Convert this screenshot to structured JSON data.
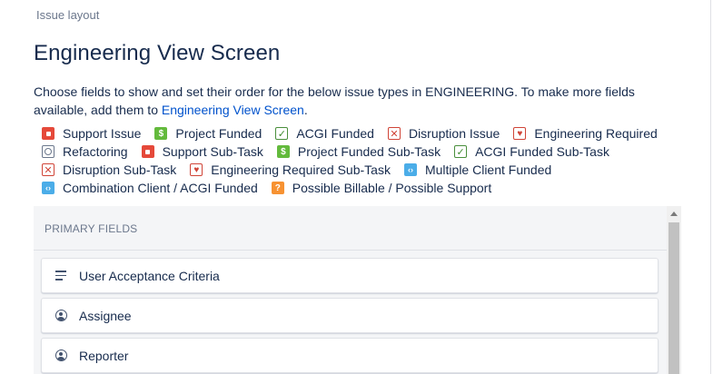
{
  "breadcrumb": "Issue layout",
  "title": "Engineering View Screen",
  "description": {
    "text": "Choose fields to show and set their order for the below issue types in ENGINEERING. To make more fields available, add them to ",
    "link": "Engineering View Screen",
    "suffix": "."
  },
  "issue_types": [
    [
      {
        "label": "Support Issue",
        "icon": "bug-icon",
        "glyph": ""
      },
      {
        "label": "Project Funded",
        "icon": "dollar-icon",
        "glyph": "$"
      },
      {
        "label": "ACGI Funded",
        "icon": "check-icon",
        "glyph": "✓"
      },
      {
        "label": "Disruption Issue",
        "icon": "x-icon",
        "glyph": "✕"
      },
      {
        "label": "Engineering Required",
        "icon": "heart-icon",
        "glyph": "♥"
      }
    ],
    [
      {
        "label": "Refactoring",
        "icon": "refactor-icon",
        "glyph": ""
      },
      {
        "label": "Support Sub-Task",
        "icon": "bug-icon",
        "glyph": ""
      },
      {
        "label": "Project Funded Sub-Task",
        "icon": "dollar-icon",
        "glyph": "$"
      },
      {
        "label": "ACGI Funded Sub-Task",
        "icon": "check-icon",
        "glyph": "✓"
      }
    ],
    [
      {
        "label": "Disruption Sub-Task",
        "icon": "x-icon",
        "glyph": "✕"
      },
      {
        "label": "Engineering Required Sub-Task",
        "icon": "heart-icon",
        "glyph": "♥"
      },
      {
        "label": "Multiple Client Funded",
        "icon": "code-icon",
        "glyph": "‹›"
      }
    ],
    [
      {
        "label": "Combination Client / ACGI Funded",
        "icon": "code-icon",
        "glyph": "‹›"
      },
      {
        "label": "Possible Billable / Possible Support",
        "icon": "question-icon",
        "glyph": "?"
      }
    ]
  ],
  "panel": {
    "header": "PRIMARY FIELDS",
    "fields": [
      {
        "label": "User Acceptance Criteria",
        "icon": "text-lines-icon"
      },
      {
        "label": "Assignee",
        "icon": "user-icon"
      },
      {
        "label": "Reporter",
        "icon": "user-icon"
      }
    ]
  },
  "colors": {
    "link": "#0052cc",
    "bug_red": "#e5493a",
    "funded_green": "#63ba3c",
    "code_blue": "#4bade8",
    "question_orange": "#f79232",
    "panel_bg": "#f4f5f7"
  }
}
